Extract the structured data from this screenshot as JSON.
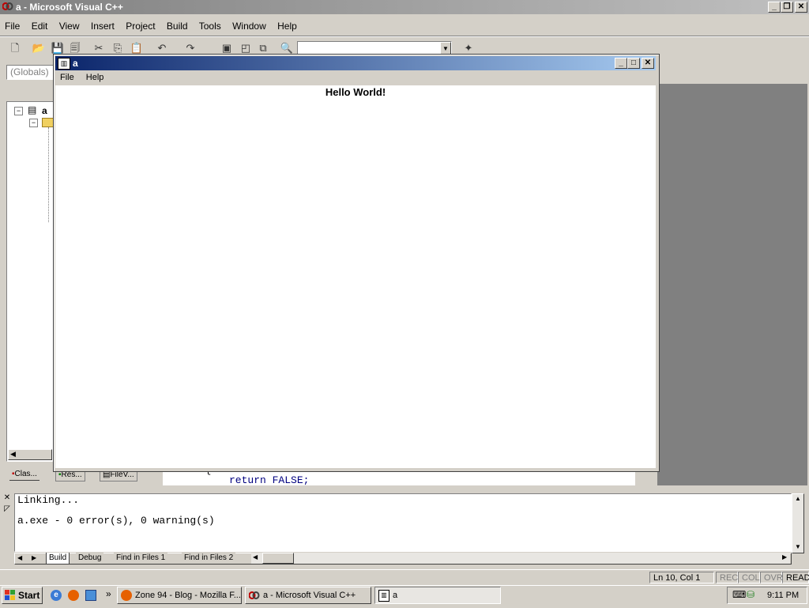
{
  "app": {
    "title": "a - Microsoft Visual C++",
    "icon": "vc-icon"
  },
  "menu": [
    "File",
    "Edit",
    "View",
    "Insert",
    "Project",
    "Build",
    "Tools",
    "Window",
    "Help"
  ],
  "toolbar": {
    "globals_value": "(Globals)",
    "find_value": ""
  },
  "child_window": {
    "title": "a",
    "menu": [
      "File",
      "Help"
    ],
    "content_text": "Hello World!"
  },
  "workspace": {
    "tree_root_label": "a",
    "tabs": [
      "Clas...",
      "Res...",
      "FileV..."
    ]
  },
  "editor": {
    "code_lines": [
      "{",
      "return FALSE;"
    ]
  },
  "output": {
    "lines": [
      "Linking...",
      "a.exe - 0 error(s), 0 warning(s)"
    ],
    "tabs": [
      "Build",
      "Debug",
      "Find in Files 1",
      "Find in Files 2"
    ]
  },
  "status": {
    "position": "Ln 10, Col 1",
    "indicators": [
      "REC",
      "COL",
      "OVR",
      "READ"
    ]
  },
  "taskbar": {
    "start_label": "Start",
    "tasks": [
      "Zone 94 - Blog - Mozilla F...",
      "a - Microsoft Visual C++",
      "a"
    ],
    "clock": "9:11 PM",
    "quicklaunch_more": "»"
  },
  "colors": {
    "titlebar_start": "#0a246a",
    "titlebar_end": "#a6caf0",
    "inactive_title": "#808080",
    "code_keyword": "#000080"
  }
}
